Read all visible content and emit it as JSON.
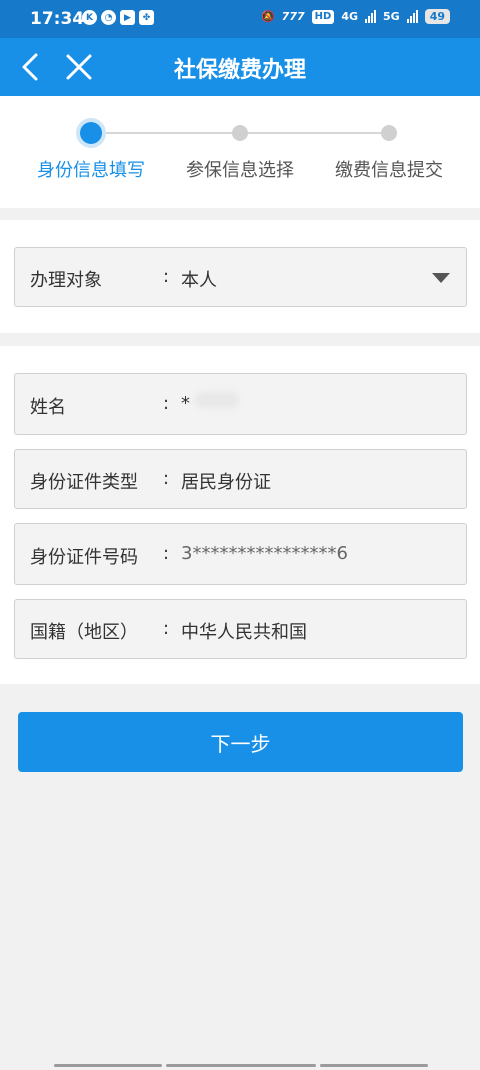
{
  "status_bar": {
    "time": "17:34",
    "hd_badge": "HD",
    "network_4g": "4G",
    "network_5g": "5G",
    "battery": "49"
  },
  "nav": {
    "title": "社保缴费办理"
  },
  "steps": [
    {
      "label": "身份信息填写",
      "active": true
    },
    {
      "label": "参保信息选择",
      "active": false
    },
    {
      "label": "缴费信息提交",
      "active": false
    }
  ],
  "target_field": {
    "label": "办理对象",
    "colon": ":",
    "value": "本人"
  },
  "identity_fields": [
    {
      "label": "姓名",
      "colon": ":",
      "value": "*"
    },
    {
      "label": "身份证件类型",
      "colon": ":",
      "value": "居民身份证"
    },
    {
      "label": "身份证件号码",
      "colon": ":",
      "value": "3****************6"
    },
    {
      "label": "国籍（地区）",
      "colon": ":",
      "value": "中华人民共和国"
    }
  ],
  "next_button": {
    "label": "下一步"
  },
  "colors": {
    "status_bar": "#1679c9",
    "nav_bar": "#1990e8",
    "accent": "#1990e8"
  }
}
